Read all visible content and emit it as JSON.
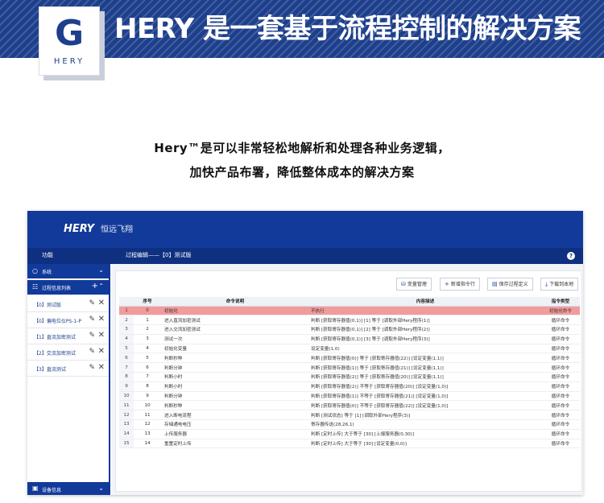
{
  "banner": {
    "logo_letter": "G",
    "logo_text": "HERY",
    "title": "HERY 是一套基于流程控制的解决方案"
  },
  "intro": {
    "line1": "Hery™是可以非常轻松地解析和处理各种业务逻辑，",
    "line2": "加快产品布署，降低整体成本的解决方案"
  },
  "app": {
    "brand": "HERY",
    "brand_cn": "恒远飞翔",
    "sub_left": "功能",
    "sub_title": "过程编辑——【0】测试版",
    "sidebar": {
      "system_label": "系统",
      "process_list_label": "过程信息列表",
      "items": [
        {
          "label": "【0】测试版"
        },
        {
          "label": "【0】偏电位仪PS-1-P"
        },
        {
          "label": "【1】直流加密测试"
        },
        {
          "label": "【2】交流加密测试"
        },
        {
          "label": "【3】直流测试"
        }
      ],
      "footer_label": "设备信息"
    },
    "toolbar": {
      "var_manage": "变量管理",
      "add_cmd": "新增指令行",
      "save_def": "保存过程定义",
      "download_local": "下载到本地"
    },
    "table": {
      "headers": [
        "",
        "序号",
        "命令说明",
        "内容描述",
        "指令类型"
      ],
      "rows": [
        {
          "idx": "1",
          "seq": "0",
          "desc": "初始化",
          "content": "不执行",
          "type": "初始化命令",
          "highlight": true
        },
        {
          "idx": "2",
          "seq": "1",
          "desc": "进入直流加密测试",
          "content": "判断 [获取寄存器值(0,1)] [1] 等于 [调取外部Hery程序(1)]",
          "type": "循环命令"
        },
        {
          "idx": "3",
          "seq": "2",
          "desc": "进入交流加密测试",
          "content": "判断 [获取寄存器值(0,1)] [2] 等于 [调取外部Hery程序(2)]",
          "type": "循环命令"
        },
        {
          "idx": "4",
          "seq": "3",
          "desc": "测试一次",
          "content": "判断 [获取寄存器值(0,1)] [3] 等于 [调取外部Hery程序(3)]",
          "type": "循环命令"
        },
        {
          "idx": "5",
          "seq": "4",
          "desc": "初始化变量",
          "content": "设定变量(1,0)",
          "type": "循环命令"
        },
        {
          "idx": "6",
          "seq": "5",
          "desc": "判断秒种",
          "content": "判断 [获取寄存器值(0)] 等于 [获取寄存器值(22)] [设定变量(1,1)]",
          "type": "循环命令"
        },
        {
          "idx": "7",
          "seq": "6",
          "desc": "判断分钟",
          "content": "判断 [获取寄存器值(1)] 等于 [获取寄存器值(21)] [设定变量(1,1)]",
          "type": "循环命令"
        },
        {
          "idx": "8",
          "seq": "7",
          "desc": "判断小时",
          "content": "判断 [获取寄存器值(2)] 等于 [获取寄存器值(20)] [设定变量(1,1)]",
          "type": "循环命令"
        },
        {
          "idx": "9",
          "seq": "8",
          "desc": "判断小时",
          "content": "判断 [获取寄存器值(2)] 不等于 [获取寄存器值(20)] [设定变量(1,0)]",
          "type": "循环命令"
        },
        {
          "idx": "10",
          "seq": "9",
          "desc": "判断分钟",
          "content": "判断 [获取寄存器值(1)] 不等于 [获取寄存器值(21)] [设定变量(1,0)]",
          "type": "循环命令"
        },
        {
          "idx": "11",
          "seq": "10",
          "desc": "判断秒种",
          "content": "判断 [获取寄存器值(0)] 不等于 [获取寄存器值(22)] [设定变量(1,0)]",
          "type": "循环命令"
        },
        {
          "idx": "12",
          "seq": "11",
          "desc": "进入断电流程",
          "content": "判断 [测试状态] 等于 [1] [调取外部Hery程序(3)]",
          "type": "循环命令"
        },
        {
          "idx": "13",
          "seq": "12",
          "desc": "存储通电电压",
          "content": "寄存器传送(28,26,1)",
          "type": "循环命令"
        },
        {
          "idx": "14",
          "seq": "13",
          "desc": "上传服务器",
          "content": "判断 [定时上传] 大于等于 [30] [上报服务器(0,30)]",
          "type": "循环命令"
        },
        {
          "idx": "15",
          "seq": "14",
          "desc": "重置定时上传",
          "content": "判断 [定时上传] 大于等于 [30] [设定变量(0,0)]",
          "type": "循环命令"
        }
      ]
    }
  }
}
